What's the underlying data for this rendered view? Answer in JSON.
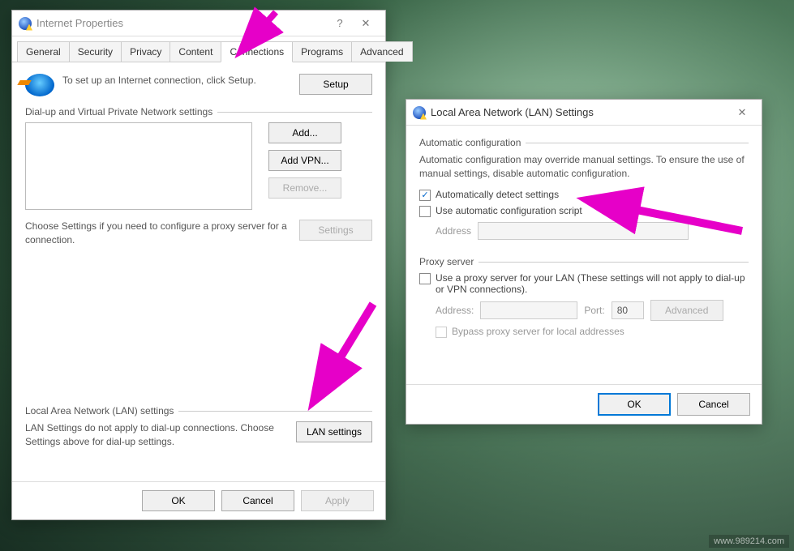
{
  "watermark": "www.989214.com",
  "dialog1": {
    "title": "Internet Properties",
    "tabs": [
      "General",
      "Security",
      "Privacy",
      "Content",
      "Connections",
      "Programs",
      "Advanced"
    ],
    "active_tab": 4,
    "setup_text": "To set up an Internet connection, click Setup.",
    "setup_btn": "Setup",
    "group_dialup": "Dial-up and Virtual Private Network settings",
    "btn_add": "Add...",
    "btn_addvpn": "Add VPN...",
    "btn_remove": "Remove...",
    "note_settings": "Choose Settings if you need to configure a proxy server for a connection.",
    "btn_settings": "Settings",
    "group_lan": "Local Area Network (LAN) settings",
    "note_lan": "LAN Settings do not apply to dial-up connections. Choose Settings above for dial-up settings.",
    "btn_lan": "LAN settings",
    "btn_ok": "OK",
    "btn_cancel": "Cancel",
    "btn_apply": "Apply"
  },
  "dialog2": {
    "title": "Local Area Network (LAN) Settings",
    "group_auto": "Automatic configuration",
    "auto_desc": "Automatic configuration may override manual settings. To ensure the use of manual settings, disable automatic configuration.",
    "chk_auto_detect": "Automatically detect settings",
    "chk_auto_script": "Use automatic configuration script",
    "lbl_address": "Address",
    "group_proxy": "Proxy server",
    "chk_proxy": "Use a proxy server for your LAN (These settings will not apply to dial-up or VPN connections).",
    "lbl_address2": "Address:",
    "lbl_port": "Port:",
    "port_value": "80",
    "btn_advanced": "Advanced",
    "chk_bypass": "Bypass proxy server for local addresses",
    "btn_ok": "OK",
    "btn_cancel": "Cancel"
  }
}
